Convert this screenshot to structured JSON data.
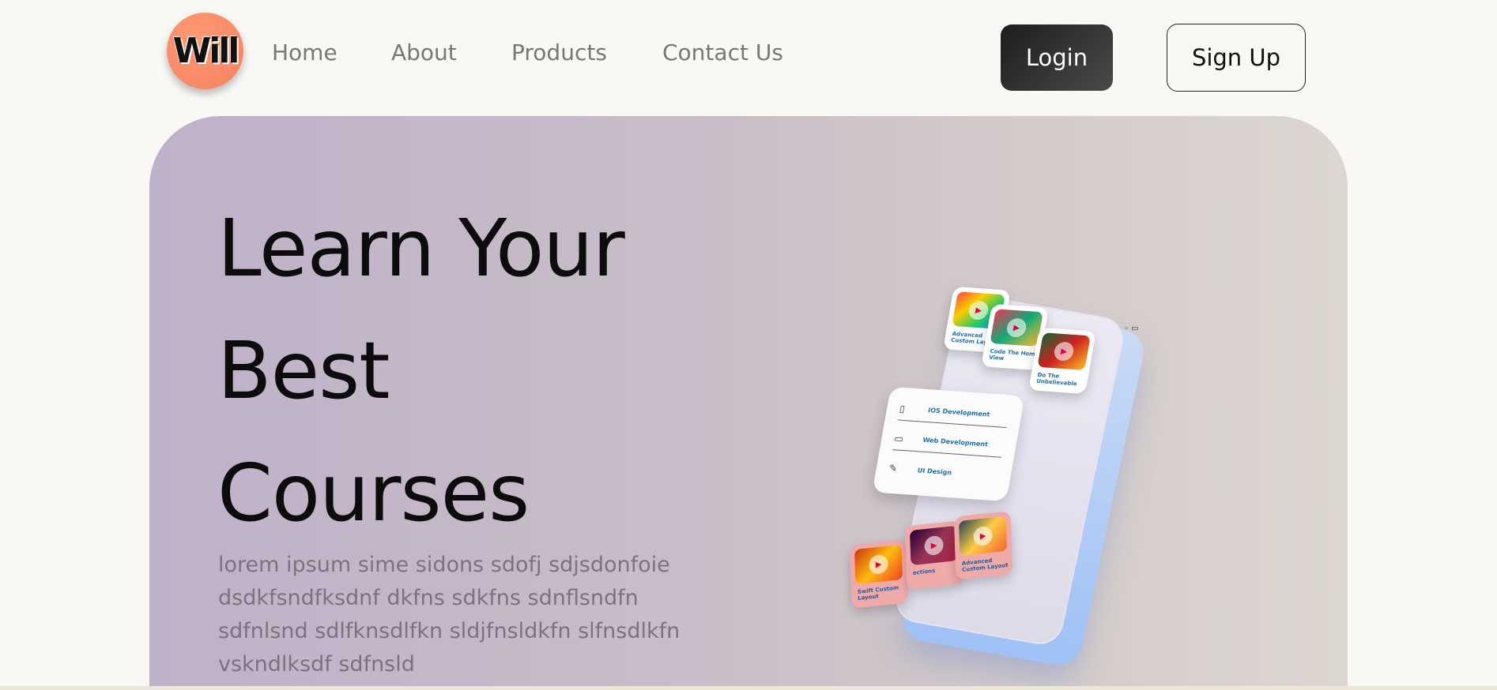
{
  "nav": {
    "logo_text": "Will",
    "links": [
      "Home",
      "About",
      "Products",
      "Contact Us"
    ],
    "login_label": "Login",
    "signup_label": "Sign Up"
  },
  "hero": {
    "title_lines": [
      "Learn Your",
      "Best",
      "Courses"
    ],
    "description": "lorem ipsum sime sidons sdofj sdjsdonfoie dsdkfsndfksdnf dkfns sdkfns sdnflsndfn sdfnlsnd sdlfknsdlfkn sldjfnsldkfn slfnsdlkfn vskndlksdf sdfnsld"
  },
  "illustration": {
    "menu_items": [
      "IOS Development",
      "Web Development",
      "UI Design"
    ],
    "menu_icons": [
      "phone-icon",
      "monitor-icon",
      "pen-icon"
    ],
    "video_cards": [
      "Advanced Custom Layout",
      "Code The Home View",
      "Do The Unbelievable"
    ],
    "pink_cards": [
      "Swift Custom Layout",
      "ections",
      "Advanced Custom Layout"
    ]
  },
  "colors": {
    "background": "#faf8f5",
    "accent_logo": "#f5805f",
    "login_bg": "#1d1d1d",
    "hero_gradient_start": "#bfb1c9",
    "hero_gradient_end": "#dcd6d1"
  }
}
